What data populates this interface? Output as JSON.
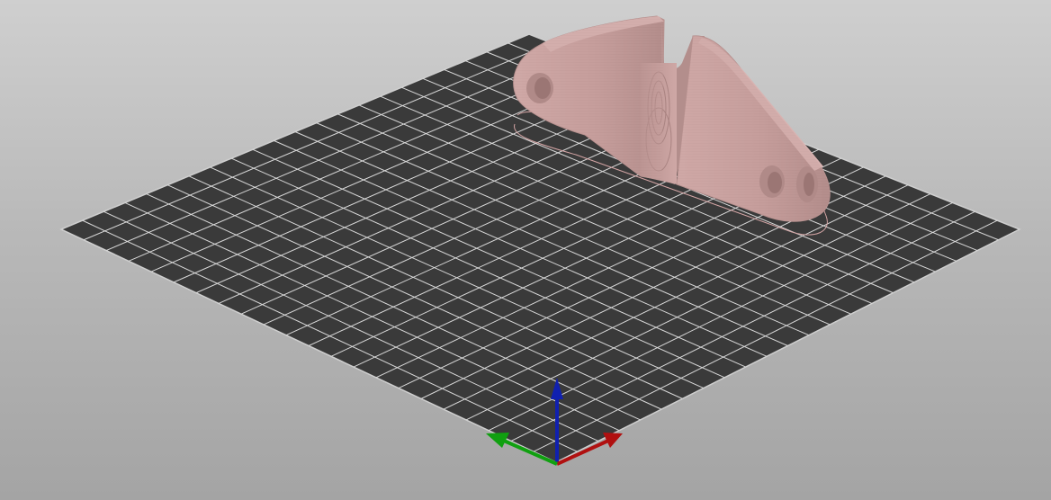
{
  "viewport": {
    "view_mode": "3D preview",
    "background_colors": [
      "#cfcfcf",
      "#a4a4a4"
    ]
  },
  "build_plate": {
    "color": "#3a3a3a",
    "grid_line_color": "#d8d8d8",
    "grid_divisions": 22
  },
  "model": {
    "color": "#c9a09e",
    "shade_color": "#a57d7b",
    "outline_color": "#d4a5a5"
  },
  "axes": {
    "x_color": "#b01010",
    "y_color": "#10a010",
    "z_color": "#1020b0",
    "x_icon": "x-axis-arrow-icon",
    "y_icon": "y-axis-arrow-icon",
    "z_icon": "z-axis-arrow-icon"
  }
}
